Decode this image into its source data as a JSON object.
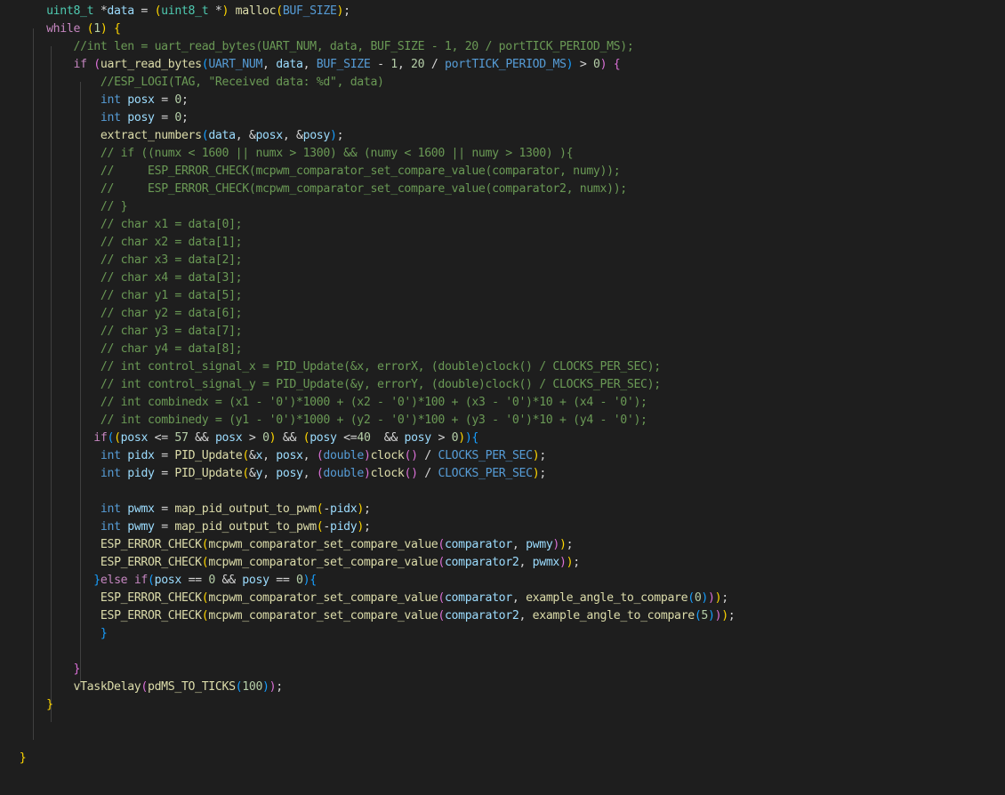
{
  "editor": {
    "theme": {
      "background": "#1e1e1e"
    },
    "lines": [
      {
        "indent": 6,
        "tokens": [
          [
            "uint8_t",
            "type"
          ],
          [
            " *",
            "op"
          ],
          [
            "data",
            "var"
          ],
          [
            " = ",
            "op"
          ],
          [
            "(",
            "b1"
          ],
          [
            "uint8_t",
            "type"
          ],
          [
            " *",
            "op"
          ],
          [
            ")",
            "b1"
          ],
          [
            " ",
            "op"
          ],
          [
            "malloc",
            "fn"
          ],
          [
            "(",
            "b1"
          ],
          [
            "BUF_SIZE",
            "mac"
          ],
          [
            ")",
            "b1"
          ],
          [
            ";",
            "op"
          ]
        ]
      },
      {
        "indent": 6,
        "tokens": [
          [
            "while",
            "ctl"
          ],
          [
            " ",
            "op"
          ],
          [
            "(",
            "b1"
          ],
          [
            "1",
            "num"
          ],
          [
            ")",
            "b1"
          ],
          [
            " ",
            "op"
          ],
          [
            "{",
            "b1"
          ]
        ]
      },
      {
        "indent": 10,
        "tokens": [
          [
            "//int len = uart_read_bytes(UART_NUM, data, BUF_SIZE - 1, 20 / portTICK_PERIOD_MS);",
            "cm"
          ]
        ]
      },
      {
        "indent": 10,
        "tokens": [
          [
            "if",
            "ctl"
          ],
          [
            " ",
            "op"
          ],
          [
            "(",
            "b2"
          ],
          [
            "uart_read_bytes",
            "fn"
          ],
          [
            "(",
            "b3"
          ],
          [
            "UART_NUM",
            "mac"
          ],
          [
            ", ",
            "op"
          ],
          [
            "data",
            "var"
          ],
          [
            ", ",
            "op"
          ],
          [
            "BUF_SIZE",
            "mac"
          ],
          [
            " - ",
            "op"
          ],
          [
            "1",
            "num"
          ],
          [
            ", ",
            "op"
          ],
          [
            "20",
            "num"
          ],
          [
            " / ",
            "op"
          ],
          [
            "portTICK_PERIOD_MS",
            "mac"
          ],
          [
            ")",
            "b3"
          ],
          [
            " > ",
            "op"
          ],
          [
            "0",
            "num"
          ],
          [
            ")",
            "b2"
          ],
          [
            " ",
            "op"
          ],
          [
            "{",
            "b2"
          ]
        ]
      },
      {
        "indent": 14,
        "tokens": [
          [
            "//ESP_LOGI(TAG, \"Received data: %d\", data)",
            "cm"
          ]
        ]
      },
      {
        "indent": 14,
        "tokens": [
          [
            "int",
            "kw"
          ],
          [
            " ",
            "op"
          ],
          [
            "posx",
            "var"
          ],
          [
            " = ",
            "op"
          ],
          [
            "0",
            "num"
          ],
          [
            ";",
            "op"
          ]
        ]
      },
      {
        "indent": 14,
        "tokens": [
          [
            "int",
            "kw"
          ],
          [
            " ",
            "op"
          ],
          [
            "posy",
            "var"
          ],
          [
            " = ",
            "op"
          ],
          [
            "0",
            "num"
          ],
          [
            ";",
            "op"
          ]
        ]
      },
      {
        "indent": 14,
        "tokens": [
          [
            "extract_numbers",
            "fn"
          ],
          [
            "(",
            "b3"
          ],
          [
            "data",
            "var"
          ],
          [
            ", &",
            "op"
          ],
          [
            "posx",
            "var"
          ],
          [
            ", &",
            "op"
          ],
          [
            "posy",
            "var"
          ],
          [
            ")",
            "b3"
          ],
          [
            ";",
            "op"
          ]
        ]
      },
      {
        "indent": 14,
        "tokens": [
          [
            "// if ((numx < 1600 || numx > 1300) && (numy < 1600 || numy > 1300) ){",
            "cm"
          ]
        ]
      },
      {
        "indent": 14,
        "tokens": [
          [
            "//     ESP_ERROR_CHECK(mcpwm_comparator_set_compare_value(comparator, numy));",
            "cm"
          ]
        ]
      },
      {
        "indent": 14,
        "tokens": [
          [
            "//     ESP_ERROR_CHECK(mcpwm_comparator_set_compare_value(comparator2, numx));",
            "cm"
          ]
        ]
      },
      {
        "indent": 14,
        "tokens": [
          [
            "// }",
            "cm"
          ]
        ]
      },
      {
        "indent": 14,
        "tokens": [
          [
            "// char x1 = data[0];",
            "cm"
          ]
        ]
      },
      {
        "indent": 14,
        "tokens": [
          [
            "// char x2 = data[1];",
            "cm"
          ]
        ]
      },
      {
        "indent": 14,
        "tokens": [
          [
            "// char x3 = data[2];",
            "cm"
          ]
        ]
      },
      {
        "indent": 14,
        "tokens": [
          [
            "// char x4 = data[3];",
            "cm"
          ]
        ]
      },
      {
        "indent": 14,
        "tokens": [
          [
            "// char y1 = data[5];",
            "cm"
          ]
        ]
      },
      {
        "indent": 14,
        "tokens": [
          [
            "// char y2 = data[6];",
            "cm"
          ]
        ]
      },
      {
        "indent": 14,
        "tokens": [
          [
            "// char y3 = data[7];",
            "cm"
          ]
        ]
      },
      {
        "indent": 14,
        "tokens": [
          [
            "// char y4 = data[8];",
            "cm"
          ]
        ]
      },
      {
        "indent": 14,
        "tokens": [
          [
            "// int control_signal_x = PID_Update(&x, errorX, (double)clock() / CLOCKS_PER_SEC);",
            "cm"
          ]
        ]
      },
      {
        "indent": 14,
        "tokens": [
          [
            "// int control_signal_y = PID_Update(&y, errorY, (double)clock() / CLOCKS_PER_SEC);",
            "cm"
          ]
        ]
      },
      {
        "indent": 14,
        "tokens": [
          [
            "// int combinedx = (x1 - '0')*1000 + (x2 - '0')*100 + (x3 - '0')*10 + (x4 - '0');",
            "cm"
          ]
        ]
      },
      {
        "indent": 14,
        "tokens": [
          [
            "// int combinedy = (y1 - '0')*1000 + (y2 - '0')*100 + (y3 - '0')*10 + (y4 - '0');",
            "cm"
          ]
        ]
      },
      {
        "indent": 13,
        "tokens": [
          [
            "if",
            "ctl"
          ],
          [
            "(",
            "b3"
          ],
          [
            "(",
            "b1"
          ],
          [
            "posx",
            "var"
          ],
          [
            " <= ",
            "op"
          ],
          [
            "57",
            "num"
          ],
          [
            " && ",
            "op"
          ],
          [
            "posx",
            "var"
          ],
          [
            " > ",
            "op"
          ],
          [
            "0",
            "num"
          ],
          [
            ")",
            "b1"
          ],
          [
            " && ",
            "op"
          ],
          [
            "(",
            "b1"
          ],
          [
            "posy",
            "var"
          ],
          [
            " <=",
            "op"
          ],
          [
            "40",
            "num"
          ],
          [
            "  && ",
            "op"
          ],
          [
            "posy",
            "var"
          ],
          [
            " > ",
            "op"
          ],
          [
            "0",
            "num"
          ],
          [
            ")",
            "b1"
          ],
          [
            ")",
            "b3"
          ],
          [
            "{",
            "b3"
          ]
        ]
      },
      {
        "indent": 14,
        "tokens": [
          [
            "int",
            "kw"
          ],
          [
            " ",
            "op"
          ],
          [
            "pidx",
            "var"
          ],
          [
            " = ",
            "op"
          ],
          [
            "PID_Update",
            "fn"
          ],
          [
            "(",
            "b1"
          ],
          [
            "&",
            "op"
          ],
          [
            "x",
            "var"
          ],
          [
            ", ",
            "op"
          ],
          [
            "posx",
            "var"
          ],
          [
            ", ",
            "op"
          ],
          [
            "(",
            "b2"
          ],
          [
            "double",
            "kw"
          ],
          [
            ")",
            "b2"
          ],
          [
            "clock",
            "fn"
          ],
          [
            "(",
            "b2"
          ],
          [
            ")",
            "b2"
          ],
          [
            " / ",
            "op"
          ],
          [
            "CLOCKS_PER_SEC",
            "mac"
          ],
          [
            ")",
            "b1"
          ],
          [
            ";",
            "op"
          ]
        ]
      },
      {
        "indent": 14,
        "tokens": [
          [
            "int",
            "kw"
          ],
          [
            " ",
            "op"
          ],
          [
            "pidy",
            "var"
          ],
          [
            " = ",
            "op"
          ],
          [
            "PID_Update",
            "fn"
          ],
          [
            "(",
            "b1"
          ],
          [
            "&",
            "op"
          ],
          [
            "y",
            "var"
          ],
          [
            ", ",
            "op"
          ],
          [
            "posy",
            "var"
          ],
          [
            ", ",
            "op"
          ],
          [
            "(",
            "b2"
          ],
          [
            "double",
            "kw"
          ],
          [
            ")",
            "b2"
          ],
          [
            "clock",
            "fn"
          ],
          [
            "(",
            "b2"
          ],
          [
            ")",
            "b2"
          ],
          [
            " / ",
            "op"
          ],
          [
            "CLOCKS_PER_SEC",
            "mac"
          ],
          [
            ")",
            "b1"
          ],
          [
            ";",
            "op"
          ]
        ]
      },
      {
        "indent": 14,
        "tokens": []
      },
      {
        "indent": 14,
        "tokens": [
          [
            "int",
            "kw"
          ],
          [
            " ",
            "op"
          ],
          [
            "pwmx",
            "var"
          ],
          [
            " = ",
            "op"
          ],
          [
            "map_pid_output_to_pwm",
            "fn"
          ],
          [
            "(",
            "b1"
          ],
          [
            "-",
            "op"
          ],
          [
            "pidx",
            "var"
          ],
          [
            ")",
            "b1"
          ],
          [
            ";",
            "op"
          ]
        ]
      },
      {
        "indent": 14,
        "tokens": [
          [
            "int",
            "kw"
          ],
          [
            " ",
            "op"
          ],
          [
            "pwmy",
            "var"
          ],
          [
            " = ",
            "op"
          ],
          [
            "map_pid_output_to_pwm",
            "fn"
          ],
          [
            "(",
            "b1"
          ],
          [
            "-",
            "op"
          ],
          [
            "pidy",
            "var"
          ],
          [
            ")",
            "b1"
          ],
          [
            ";",
            "op"
          ]
        ]
      },
      {
        "indent": 14,
        "tokens": [
          [
            "ESP_ERROR_CHECK",
            "fn"
          ],
          [
            "(",
            "b1"
          ],
          [
            "mcpwm_comparator_set_compare_value",
            "fn"
          ],
          [
            "(",
            "b2"
          ],
          [
            "comparator",
            "var"
          ],
          [
            ", ",
            "op"
          ],
          [
            "pwmy",
            "var"
          ],
          [
            ")",
            "b2"
          ],
          [
            ")",
            "b1"
          ],
          [
            ";",
            "op"
          ]
        ]
      },
      {
        "indent": 14,
        "tokens": [
          [
            "ESP_ERROR_CHECK",
            "fn"
          ],
          [
            "(",
            "b1"
          ],
          [
            "mcpwm_comparator_set_compare_value",
            "fn"
          ],
          [
            "(",
            "b2"
          ],
          [
            "comparator2",
            "var"
          ],
          [
            ", ",
            "op"
          ],
          [
            "pwmx",
            "var"
          ],
          [
            ")",
            "b2"
          ],
          [
            ")",
            "b1"
          ],
          [
            ";",
            "op"
          ]
        ]
      },
      {
        "indent": 13,
        "tokens": [
          [
            "}",
            "b3"
          ],
          [
            "else",
            "ctl"
          ],
          [
            " ",
            "op"
          ],
          [
            "if",
            "ctl"
          ],
          [
            "(",
            "b3"
          ],
          [
            "posx",
            "var"
          ],
          [
            " == ",
            "op"
          ],
          [
            "0",
            "num"
          ],
          [
            " && ",
            "op"
          ],
          [
            "posy",
            "var"
          ],
          [
            " == ",
            "op"
          ],
          [
            "0",
            "num"
          ],
          [
            ")",
            "b3"
          ],
          [
            "{",
            "b3"
          ]
        ]
      },
      {
        "indent": 14,
        "tokens": [
          [
            "ESP_ERROR_CHECK",
            "fn"
          ],
          [
            "(",
            "b1"
          ],
          [
            "mcpwm_comparator_set_compare_value",
            "fn"
          ],
          [
            "(",
            "b2"
          ],
          [
            "comparator",
            "var"
          ],
          [
            ", ",
            "op"
          ],
          [
            "example_angle_to_compare",
            "fn"
          ],
          [
            "(",
            "b3"
          ],
          [
            "0",
            "num"
          ],
          [
            ")",
            "b3"
          ],
          [
            ")",
            "b2"
          ],
          [
            ")",
            "b1"
          ],
          [
            ";",
            "op"
          ]
        ]
      },
      {
        "indent": 14,
        "tokens": [
          [
            "ESP_ERROR_CHECK",
            "fn"
          ],
          [
            "(",
            "b1"
          ],
          [
            "mcpwm_comparator_set_compare_value",
            "fn"
          ],
          [
            "(",
            "b2"
          ],
          [
            "comparator2",
            "var"
          ],
          [
            ", ",
            "op"
          ],
          [
            "example_angle_to_compare",
            "fn"
          ],
          [
            "(",
            "b3"
          ],
          [
            "5",
            "num"
          ],
          [
            ")",
            "b3"
          ],
          [
            ")",
            "b2"
          ],
          [
            ")",
            "b1"
          ],
          [
            ";",
            "op"
          ]
        ]
      },
      {
        "indent": 14,
        "tokens": [
          [
            "}",
            "b3"
          ]
        ]
      },
      {
        "indent": 10,
        "tokens": []
      },
      {
        "indent": 10,
        "tokens": [
          [
            "}",
            "b2"
          ]
        ]
      },
      {
        "indent": 10,
        "tokens": [
          [
            "vTaskDelay",
            "fn"
          ],
          [
            "(",
            "b2"
          ],
          [
            "pdMS_TO_TICKS",
            "fn"
          ],
          [
            "(",
            "b3"
          ],
          [
            "100",
            "num"
          ],
          [
            ")",
            "b3"
          ],
          [
            ")",
            "b2"
          ],
          [
            ";",
            "op"
          ]
        ]
      },
      {
        "indent": 6,
        "tokens": [
          [
            "}",
            "b1"
          ]
        ]
      },
      {
        "indent": 6,
        "tokens": []
      },
      {
        "indent": 6,
        "tokens": []
      },
      {
        "indent": 2,
        "tokens": [
          [
            "}",
            "b1"
          ]
        ]
      }
    ]
  }
}
